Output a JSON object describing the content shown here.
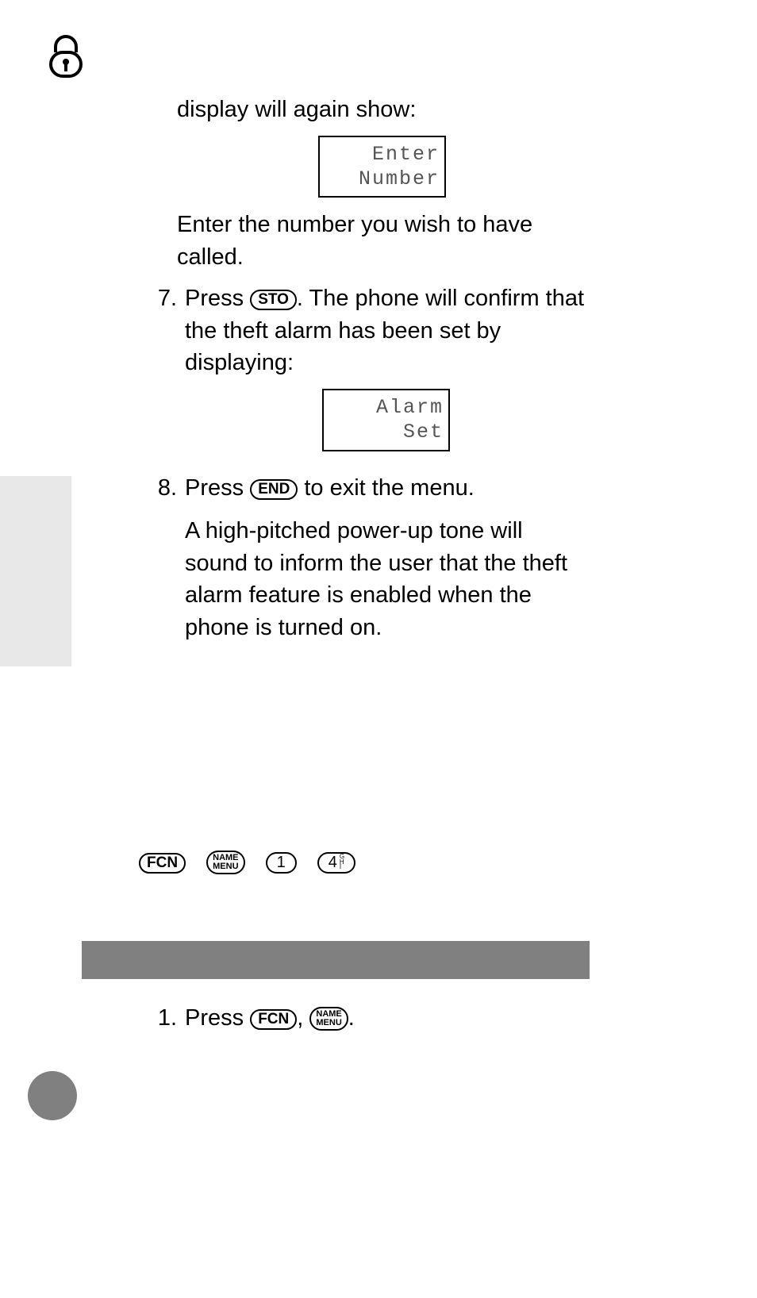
{
  "body": {
    "intro": "display will again show:",
    "lcd1": {
      "line1": "Enter",
      "line2": "Number"
    },
    "after_lcd1": "Enter the number you wish to have called.",
    "step7_num": "7.",
    "step7_a": "Press ",
    "step7_b": ". The phone will confirm that the theft alarm has been set by displaying:",
    "lcd2": {
      "line1": "Alarm",
      "line2": "Set"
    },
    "step8_num": "8.",
    "step8_a": "Press ",
    "step8_b": " to exit the menu.",
    "step8_para": "A high-pitched power-up tone will sound to inform the user that the theft alarm feature is enabled when the phone is turned on."
  },
  "keys": {
    "sto": "STO",
    "end": "END",
    "fcn": "FCN",
    "name_top": "NAME",
    "name_bot": "MENU",
    "one": "1",
    "four": "4",
    "four_letters": [
      "G",
      "H",
      "I"
    ]
  },
  "quick_steps": {
    "step1_num": "1.",
    "step1_a": "Press ",
    "step1_sep": ", ",
    "step1_end": "."
  }
}
